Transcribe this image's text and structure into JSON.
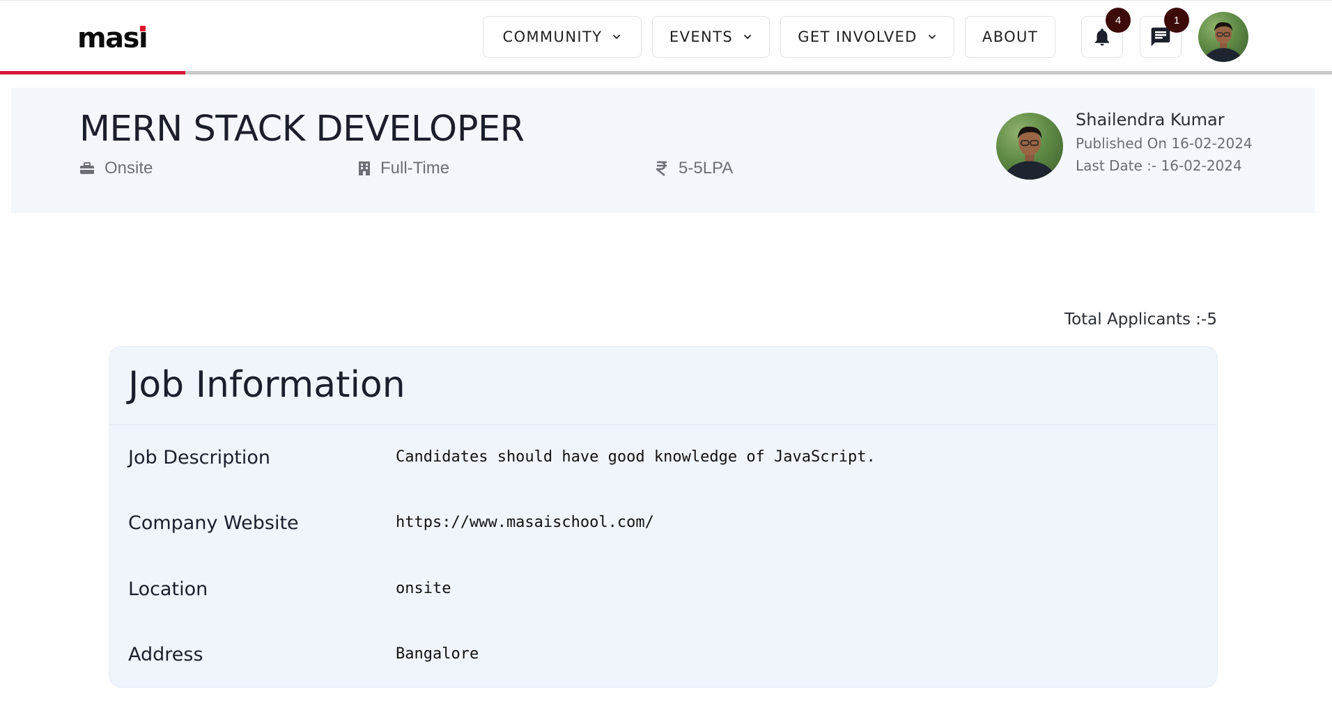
{
  "brand": {
    "logo_text_main": "mas",
    "logo_text_i": "ı"
  },
  "progress": {
    "fraction": 0.139,
    "fill_color": "#d8173a"
  },
  "nav": {
    "community": "COMMUNITY",
    "events": "EVENTS",
    "get_involved": "GET INVOLVED",
    "about": "ABOUT"
  },
  "notifications": {
    "count": "4",
    "icon": "bell-icon"
  },
  "messages": {
    "count": "1",
    "icon": "chat-icon"
  },
  "job": {
    "title": "MERN STACK DEVELOPER",
    "mode": "Onsite",
    "type": "Full-Time",
    "salary": "5-5LPA"
  },
  "author": {
    "name": "Shailendra Kumar",
    "published": "Published On 16-02-2024",
    "last_date": "Last Date :- 16-02-2024"
  },
  "applicants": "Total Applicants :-5",
  "job_info": {
    "title": "Job Information",
    "rows": [
      {
        "label": "Job Description",
        "value": "Candidates should have good knowledge of JavaScript."
      },
      {
        "label": "Company Website",
        "value": "https://www.masaischool.com/"
      },
      {
        "label": "Location",
        "value": "onsite"
      },
      {
        "label": "Address",
        "value": "Bangalore"
      }
    ]
  },
  "colors": {
    "accent": "#d8173a",
    "badge": "#3d0a0a",
    "band": "#f4f7fb",
    "card": "#f0f5fc"
  }
}
